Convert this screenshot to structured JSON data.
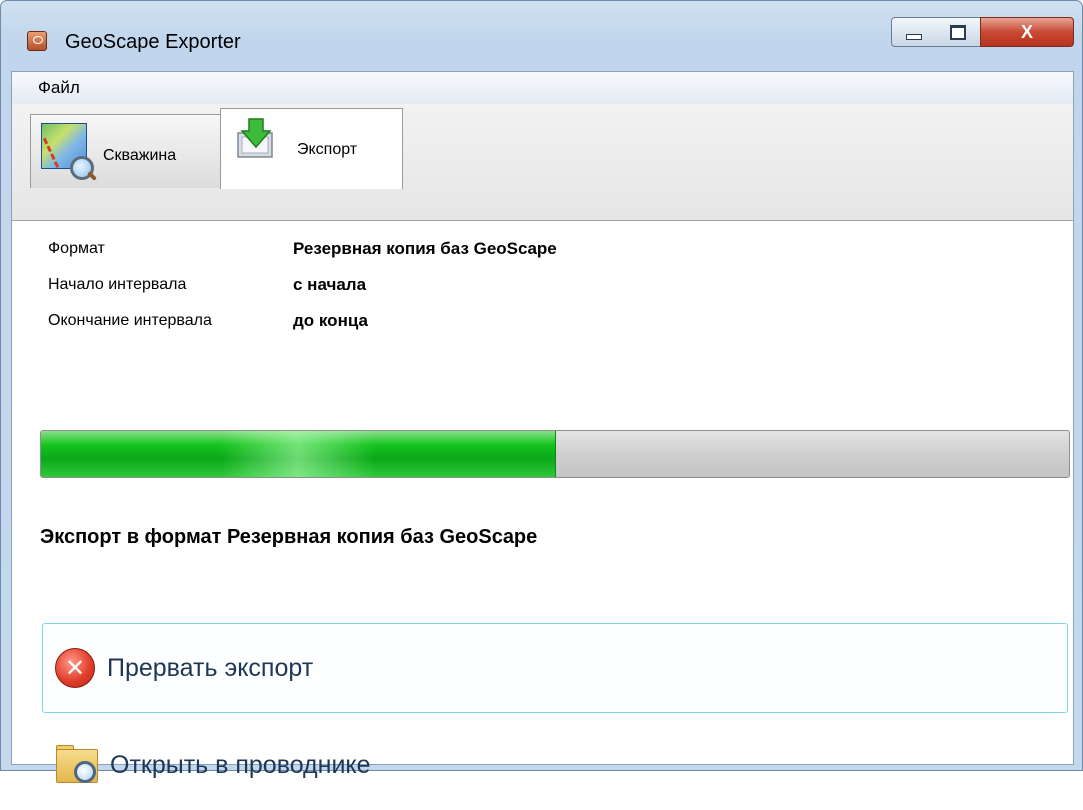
{
  "window": {
    "title": "GeoScape Exporter",
    "controls": {
      "minimize": "",
      "maximize": "",
      "close": "X"
    }
  },
  "menu": {
    "items": [
      {
        "label": "Файл"
      }
    ]
  },
  "tabs": [
    {
      "label": "Скважина",
      "icon": "map-search-icon",
      "selected": false
    },
    {
      "label": "Экспорт",
      "icon": "export-download-icon",
      "selected": true
    }
  ],
  "export_settings": {
    "format_label": "Формат",
    "format_value": "Резервная копия баз GeoScape",
    "start_label": "Начало интервала",
    "start_value": "с начала",
    "end_label": "Окончание интервала",
    "end_value": "до конца"
  },
  "progress": {
    "fraction": 0.5,
    "fill_color": "#16c41f"
  },
  "status": {
    "text": "Экспорт в формат Резервная копия баз GeoScape"
  },
  "actions": {
    "abort_label": "Прервать экспорт",
    "abort_icon": "error-x-icon",
    "open_label": "Открыть в проводнике",
    "open_icon": "folder-search-icon"
  }
}
